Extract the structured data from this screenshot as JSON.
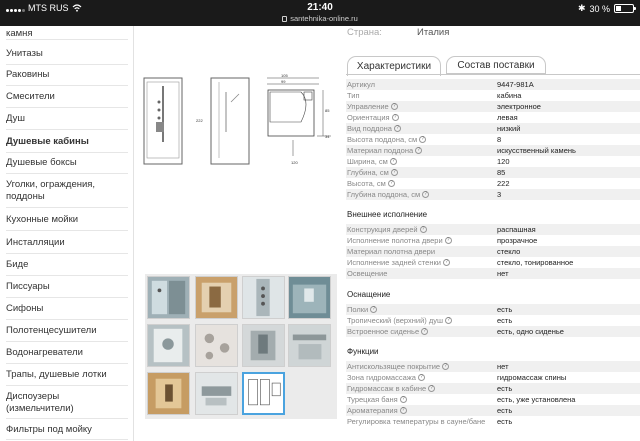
{
  "status_bar": {
    "carrier": "MTS RUS",
    "time": "21:40",
    "url": "santehnika-online.ru",
    "battery_text": "30 %",
    "battery_level": 0.3
  },
  "sidebar": {
    "items": [
      {
        "label": "камня",
        "top": 0
      },
      {
        "label": "Унитазы"
      },
      {
        "label": "Раковины"
      },
      {
        "label": "Смесители"
      },
      {
        "label": "Душ"
      },
      {
        "label": "Душевые кабины",
        "active": true
      },
      {
        "label": "Душевые боксы"
      },
      {
        "label": "Уголки, ограждения, поддоны"
      },
      {
        "label": "Кухонные мойки"
      },
      {
        "label": "Инсталляции"
      },
      {
        "label": "Биде"
      },
      {
        "label": "Писсуары"
      },
      {
        "label": "Сифоны"
      },
      {
        "label": "Полотенцесушители"
      },
      {
        "label": "Водонагреватели"
      },
      {
        "label": "Трапы, душевые лотки"
      },
      {
        "label": "Диспоузеры (измельчители)"
      },
      {
        "label": "Фильтры под мойку"
      }
    ]
  },
  "product": {
    "country_label": "Страна:",
    "country_value": "Италия",
    "tabs": [
      {
        "label": "Характеристики",
        "active": true
      },
      {
        "label": "Состав поставки",
        "active": false
      }
    ],
    "drawing_dims": [
      "105",
      "99",
      "222",
      "85",
      "120",
      "34"
    ]
  },
  "specs": {
    "main": [
      {
        "key": "Артикул",
        "value": "9447-981A",
        "help": false
      },
      {
        "key": "Тип",
        "value": "кабина",
        "help": false
      },
      {
        "key": "Управление",
        "value": "электронное",
        "help": true
      },
      {
        "key": "Ориентация",
        "value": "левая",
        "help": true
      },
      {
        "key": "Вид поддона",
        "value": "низкий",
        "help": true
      },
      {
        "key": "Высота поддона, см",
        "value": "8",
        "help": true
      },
      {
        "key": "Материал поддона",
        "value": "искусственный камень",
        "help": true
      },
      {
        "key": "Ширина, см",
        "value": "120",
        "help": true
      },
      {
        "key": "Глубина, см",
        "value": "85",
        "help": true
      },
      {
        "key": "Высота, см",
        "value": "222",
        "help": true
      },
      {
        "key": "Глубина поддона, см",
        "value": "3",
        "help": true
      }
    ],
    "exterior_title": "Внешнее исполнение",
    "exterior": [
      {
        "key": "Конструкция дверей",
        "value": "распашная",
        "help": true
      },
      {
        "key": "Исполнение полотна двери",
        "value": "прозрачное",
        "help": true
      },
      {
        "key": "Материал полотна двери",
        "value": "стекло",
        "help": false
      },
      {
        "key": "Исполнение задней стенки",
        "value": "стекло, тонированное",
        "help": true
      },
      {
        "key": "Освещение",
        "value": "нет",
        "help": false
      }
    ],
    "equipment_title": "Оснащение",
    "equipment": [
      {
        "key": "Полки",
        "value": "есть",
        "help": true
      },
      {
        "key": "Тропический (верхний) душ",
        "value": "есть",
        "help": true
      },
      {
        "key": "Встроенное сиденье",
        "value": "есть, одно сиденье",
        "help": true
      }
    ],
    "functions_title": "Функции",
    "functions": [
      {
        "key": "Антискользящее покрытие",
        "value": "нет",
        "help": true
      },
      {
        "key": "Зона гидромассажа",
        "value": "гидромассаж спины",
        "help": true
      },
      {
        "key": "Гидромассаж в кабине",
        "value": "есть",
        "help": true
      },
      {
        "key": "Турецкая баня",
        "value": "есть, уже установлена",
        "help": true
      },
      {
        "key": "Ароматерапия",
        "value": "есть",
        "help": true
      },
      {
        "key": "Регулировка температуры в сауне/бане",
        "value": "есть",
        "help": false
      }
    ]
  }
}
